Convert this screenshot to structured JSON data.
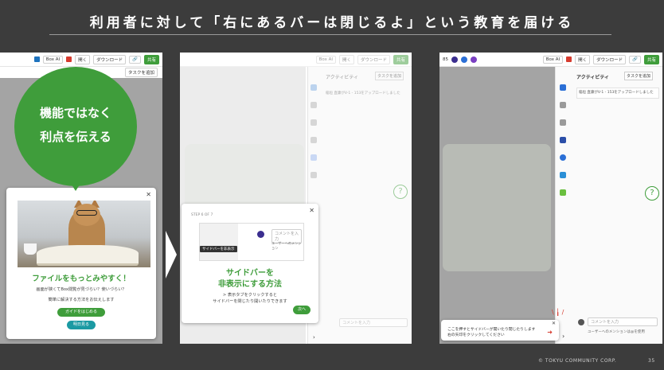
{
  "slide": {
    "title": "利用者に対して「右にあるバーは閉じるよ」という教育を届ける",
    "footer_company": "© TOKYU COMMUNITY CORP.",
    "page_number": "35"
  },
  "toolbar": {
    "box_ai": "Box AI",
    "open": "開く",
    "download": "ダウンロード",
    "share": "共有",
    "count": "85"
  },
  "activity": {
    "title": "アクティビティ",
    "add_task": "タスクを追加",
    "upload_note": "稲垣 直康がV-1 - 153をアップロードしました"
  },
  "callout": {
    "line1": "機能ではなく",
    "line2": "利点を伝える"
  },
  "guide1": {
    "title": "ファイルをもっとみやすく！",
    "text1": "画面が狭くてBox閲覧が見づらい？使いづらい？",
    "text2": "簡単に解決する方法をお伝えします",
    "start_button": "ガイドをはじめる",
    "later_button": "明日見る"
  },
  "guide2": {
    "step": "STEP 6 OF 7",
    "tooltip": "サイドバーを非表示",
    "comment_placeholder": "コメントを入力",
    "mention_hint": "ユーザーへのメンション",
    "title_line1": "サイドバーを",
    "title_line2": "非表示にする方法",
    "desc_line1": "> 表示タブをクリックすると",
    "desc_line2": "サイドバーを閉じたり開いたりできます",
    "next_button": "次へ"
  },
  "guide3": {
    "text_line1": "ここを押すとサイドバーが開いたり閉じたりします",
    "text_line2": "右の矢印をクリックしてください",
    "comment_placeholder": "コメントを入力",
    "mention_hint": "ユーザーへのメンションは@を使用"
  },
  "colors": {
    "accent_green": "#3f9d3b",
    "slide_bg": "#3c3c3c",
    "pill_teal": "#1b9aa3",
    "alert_red": "#d63b2f"
  }
}
